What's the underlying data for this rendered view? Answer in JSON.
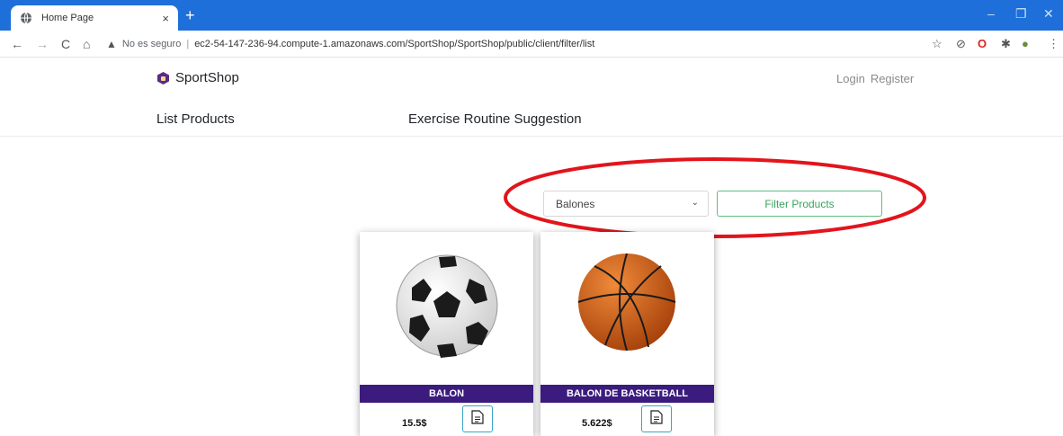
{
  "browser": {
    "tab_title": "Home Page",
    "tab_close": "×",
    "new_tab": "+",
    "window_controls": [
      "–",
      "❐",
      "✕"
    ],
    "nav": {
      "back": "←",
      "forward": "→",
      "reload": "C",
      "home": "⌂"
    },
    "security_warning_icon": "▲",
    "security_text": "No es seguro",
    "separator": "|",
    "url": "ec2-54-147-236-94.compute-1.amazonaws.com/SportShop/SportShop/public/client/filter/list",
    "extensions": [
      "☆",
      "⊘",
      "O",
      "✱",
      "●",
      "⋮"
    ]
  },
  "site": {
    "brand": "SportShop",
    "auth": {
      "login": "Login",
      "register": "Register"
    },
    "nav": {
      "list_products": "List Products",
      "exercise": "Exercise Routine Suggestion"
    }
  },
  "filter": {
    "selected": "Balones",
    "chevron": "⌄",
    "button_label": "Filter Products",
    "highlight_color": "#e2141c"
  },
  "products": [
    {
      "name": "BALON",
      "price": "15.5$",
      "image_icon": "soccer-ball-icon"
    },
    {
      "name": "BALON DE BASKETBALL",
      "price": "5.622$",
      "image_icon": "basketball-icon"
    }
  ],
  "colors": {
    "chrome_blue": "#1e6fd9",
    "card_band": "#3b1c7e",
    "filter_green": "#3aa35d",
    "detail_border": "#3aa3c7"
  }
}
